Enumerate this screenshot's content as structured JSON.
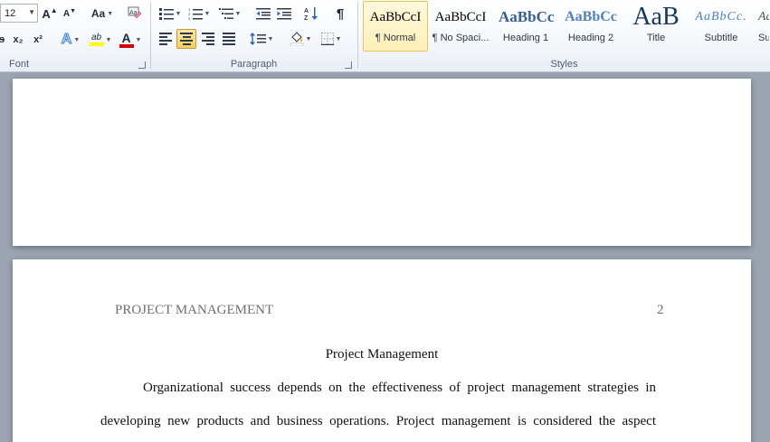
{
  "ribbon": {
    "font": {
      "label": "Font",
      "font_size": "12",
      "grow_font": "A",
      "shrink_font": "A",
      "change_case": "Aa",
      "subscript": "x₂",
      "superscript": "x²",
      "text_effects": "A",
      "highlight": "ab",
      "font_color": "A"
    },
    "paragraph": {
      "label": "Paragraph",
      "show_marks": "¶"
    },
    "styles": {
      "label": "Styles",
      "items": [
        {
          "preview": "AaBbCcI",
          "name": "¶ Normal"
        },
        {
          "preview": "AaBbCcI",
          "name": "¶ No Spaci..."
        },
        {
          "preview": "AaBbCc",
          "name": "Heading 1"
        },
        {
          "preview": "AaBbCc",
          "name": "Heading 2"
        },
        {
          "preview": "AaB",
          "name": "Title"
        },
        {
          "preview": "AaBbCc.",
          "name": "Subtitle"
        },
        {
          "preview": "Aa",
          "name": "Su"
        }
      ]
    }
  },
  "colors": {
    "highlight": "#ffff00",
    "font_color": "#d40000",
    "heading": "#365f91",
    "subtitle": "#4f81bd"
  },
  "document": {
    "running_head": "PROJECT MANAGEMENT",
    "page_number": "2",
    "title": "Project Management",
    "para_line1": "Organizational success depends on the effectiveness of project management strategies in",
    "para_line2": "developing new products and business operations. Project management is considered the aspect"
  }
}
